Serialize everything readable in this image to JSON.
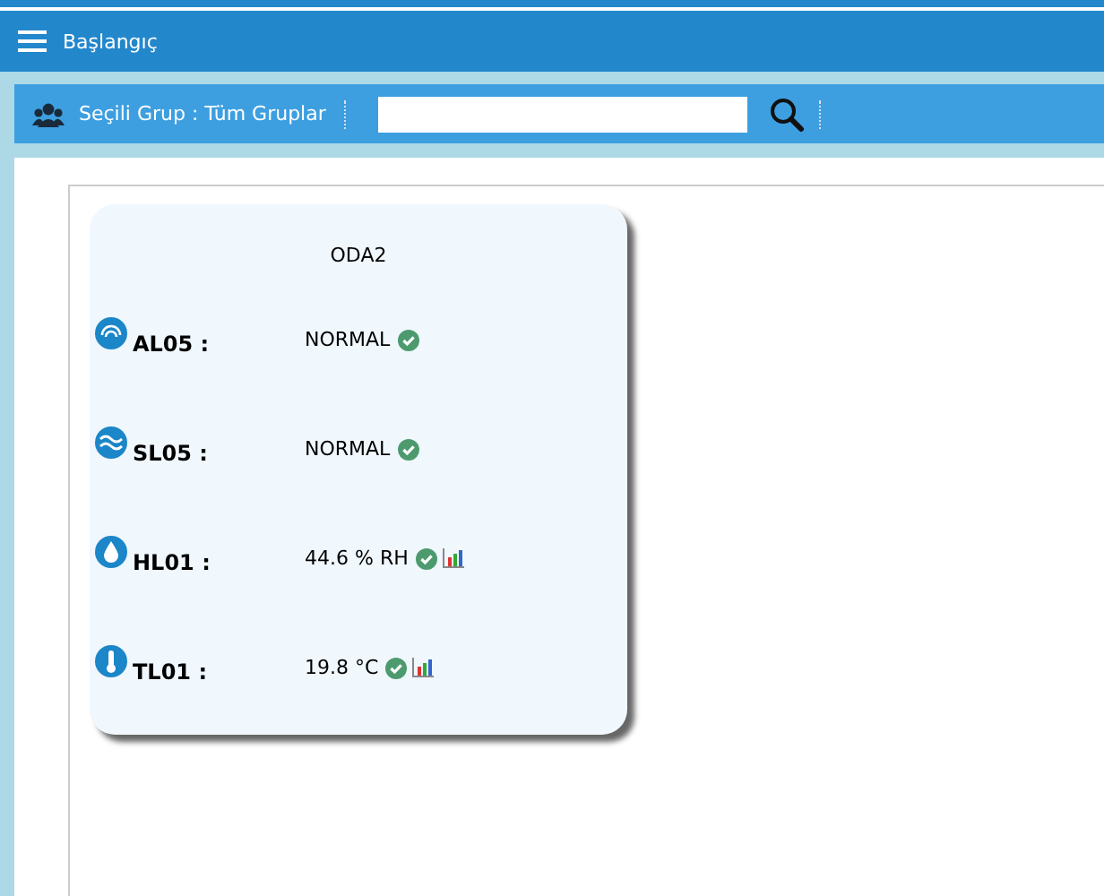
{
  "header": {
    "title": "Başlangıç"
  },
  "toolbar": {
    "group_label": "Seçili Grup : Tüm Gruplar"
  },
  "card": {
    "title": "ODA2",
    "sensors": [
      {
        "kind": "signal",
        "name": "AL05 :",
        "value": "NORMAL",
        "ok": true,
        "chart": false
      },
      {
        "kind": "wave",
        "name": "SL05 :",
        "value": "NORMAL",
        "ok": true,
        "chart": false
      },
      {
        "kind": "drop",
        "name": "HL01 :",
        "value": "44.6 % RH",
        "ok": true,
        "chart": true
      },
      {
        "kind": "thermometer",
        "name": "TL01 :",
        "value": "19.8 °C",
        "ok": true,
        "chart": true
      }
    ]
  }
}
